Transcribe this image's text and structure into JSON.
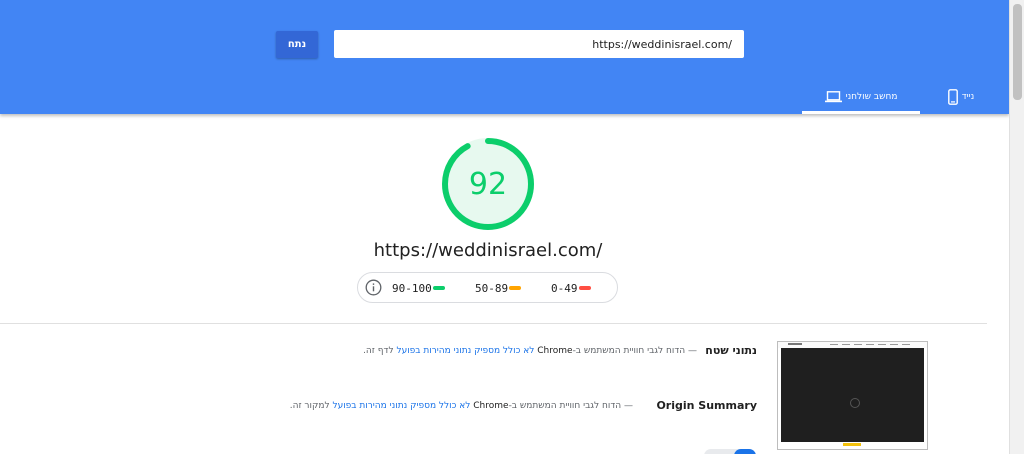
{
  "header": {
    "url_value": "https://weddinisrael.com/",
    "analyze_label": "נתח",
    "tabs": [
      {
        "label": "מחשב שולחני",
        "icon": "laptop-icon",
        "active": true
      },
      {
        "label": "נייד",
        "icon": "smartphone-icon",
        "active": false
      }
    ]
  },
  "score": {
    "value": "92",
    "value_fraction": 0.92,
    "color": "#0cce6b",
    "url": "https://weddinisrael.com/"
  },
  "legend": {
    "pass": "90-100",
    "average": "50-89",
    "fail": "0-49",
    "colors": {
      "pass": "#0cce6b",
      "average": "#ffa400",
      "fail": "#ff4e42"
    }
  },
  "field_data": {
    "title": "נתוני שטח",
    "dash": "—",
    "desc_prefix": "הדוח לגבי חוויית המשתמש ב-",
    "chrome": "Chrome",
    "desc_link": "לא כולל מספיק נתוני מהירות בפועל",
    "desc_suffix": "לדף זה."
  },
  "origin_summary": {
    "title": "Origin Summary",
    "dash": "—",
    "desc_prefix": "הדוח לגבי חוויית המשתמש ב-",
    "chrome": "Chrome",
    "desc_link": "לא כולל מספיק נתוני מהירות בפועל",
    "desc_suffix": "למקור זה."
  }
}
